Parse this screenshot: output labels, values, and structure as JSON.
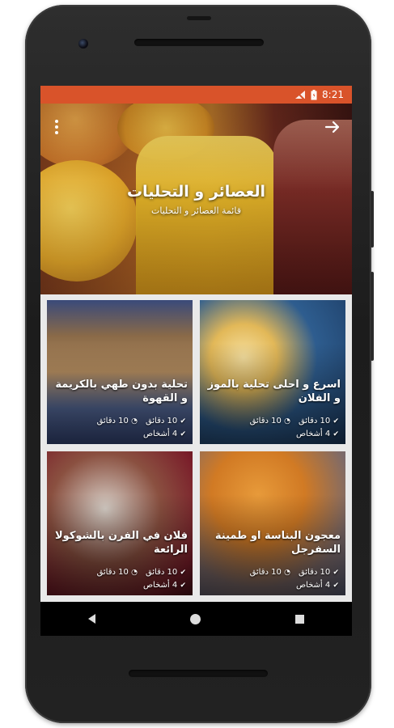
{
  "status_bar": {
    "time": "8:21",
    "color": "#d9532a",
    "icons": [
      "no-sim-icon",
      "battery-icon"
    ]
  },
  "header": {
    "title": "العصائر و التحليات",
    "subtitle": "قائمة العصائر و التحليات",
    "menu_icon": "more-vert-icon",
    "forward_icon": "arrow-forward-icon"
  },
  "recipes": [
    {
      "title": "اسرع و احلى تحلية بالموز و الفلان",
      "time": "10 دقائق",
      "prep": "10 دقائق",
      "servings": "4 أشخاص"
    },
    {
      "title": "تحلية بدون طهي بالكريمة و القهوة",
      "time": "10 دقائق",
      "prep": "10 دقائق",
      "servings": "4 أشخاص"
    },
    {
      "title": "معجون البناسة او طمينة السفرجل",
      "time": "10 دقائق",
      "prep": "10 دقائق",
      "servings": "4 أشخاص"
    },
    {
      "title": "فلان في الفرن بالشوكولا الرائعة",
      "time": "10 دقائق",
      "prep": "10 دقائق",
      "servings": "4 أشخاص"
    }
  ],
  "meta_icon": "✔",
  "nav": {
    "back_icon": "back-triangle-icon",
    "home_icon": "home-circle-icon",
    "recent_icon": "recent-square-icon"
  }
}
